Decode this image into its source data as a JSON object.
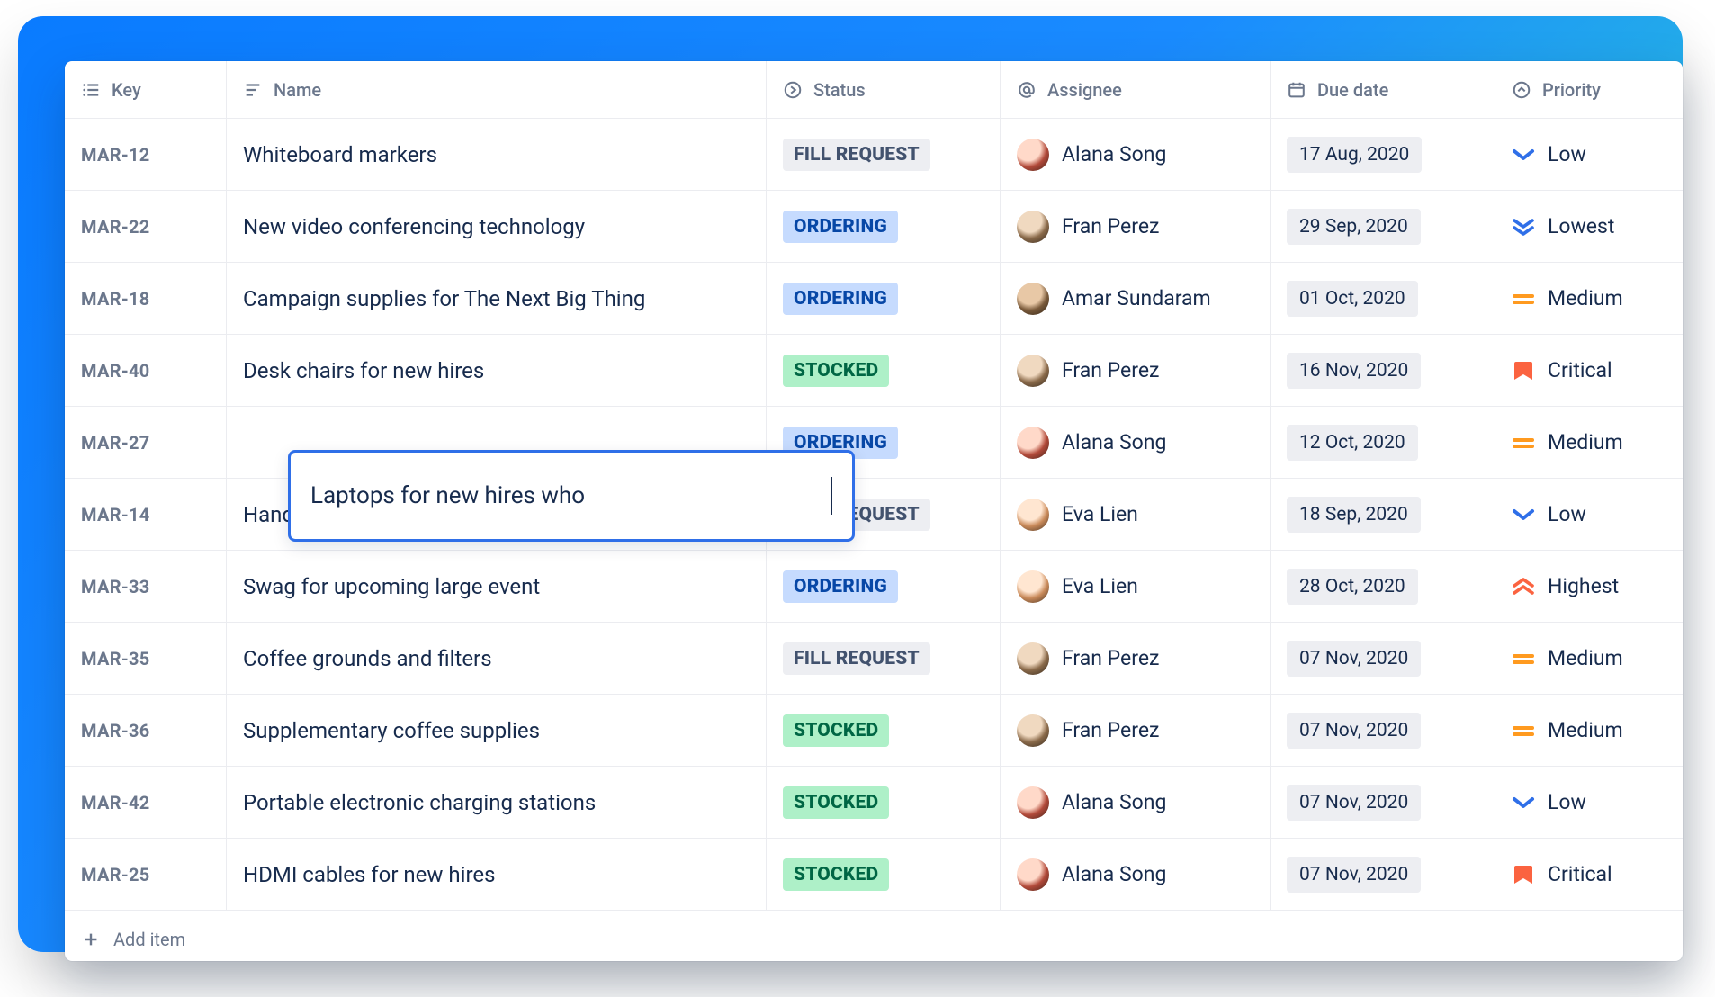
{
  "columns": {
    "key": "Key",
    "name": "Name",
    "status": "Status",
    "assignee": "Assignee",
    "due": "Due date",
    "priority": "Priority"
  },
  "footer": {
    "add_label": "Add item"
  },
  "editing": {
    "row_index": 4,
    "value": "Laptops for new hires who "
  },
  "status_styles": {
    "FILL REQUEST": "status-fill",
    "ORDERING": "status-order",
    "STOCKED": "status-stock"
  },
  "priority_icons": {
    "Low": "chev-down-1-blue",
    "Lowest": "chev-down-2-blue",
    "Medium": "bars-orange",
    "Critical": "bookmark-red",
    "Highest": "chev-up-2-red"
  },
  "avatar_classes": {
    "Alana Song": "av-alana",
    "Fran Perez": "av-fran",
    "Amar Sundaram": "av-amar",
    "Eva Lien": "av-eva"
  },
  "rows": [
    {
      "key": "MAR-12",
      "name": "Whiteboard markers",
      "status": "FILL REQUEST",
      "assignee": "Alana Song",
      "due": "17 Aug, 2020",
      "priority": "Low"
    },
    {
      "key": "MAR-22",
      "name": "New video conferencing technology",
      "status": "ORDERING",
      "assignee": "Fran Perez",
      "due": "29 Sep, 2020",
      "priority": "Lowest"
    },
    {
      "key": "MAR-18",
      "name": "Campaign supplies for The Next Big Thing",
      "status": "ORDERING",
      "assignee": "Amar Sundaram",
      "due": "01 Oct, 2020",
      "priority": "Medium"
    },
    {
      "key": "MAR-40",
      "name": "Desk chairs for new hires",
      "status": "STOCKED",
      "assignee": "Fran Perez",
      "due": "16 Nov, 2020",
      "priority": "Critical"
    },
    {
      "key": "MAR-27",
      "name": "Laptops for new hires who",
      "status": "ORDERING",
      "assignee": "Alana Song",
      "due": "12 Oct, 2020",
      "priority": "Medium"
    },
    {
      "key": "MAR-14",
      "name": "Hand sanitizer for desks and common area",
      "status": "FILL REQUEST",
      "assignee": "Eva Lien",
      "due": "18 Sep, 2020",
      "priority": "Low"
    },
    {
      "key": "MAR-33",
      "name": "Swag for upcoming large event",
      "status": "ORDERING",
      "assignee": "Eva Lien",
      "due": "28 Oct, 2020",
      "priority": "Highest"
    },
    {
      "key": "MAR-35",
      "name": "Coffee grounds and filters",
      "status": "FILL REQUEST",
      "assignee": "Fran Perez",
      "due": "07 Nov, 2020",
      "priority": "Medium"
    },
    {
      "key": "MAR-36",
      "name": "Supplementary coffee supplies",
      "status": "STOCKED",
      "assignee": "Fran Perez",
      "due": "07 Nov, 2020",
      "priority": "Medium"
    },
    {
      "key": "MAR-42",
      "name": "Portable electronic charging stations",
      "status": "STOCKED",
      "assignee": "Alana Song",
      "due": "07 Nov, 2020",
      "priority": "Low"
    },
    {
      "key": "MAR-25",
      "name": "HDMI cables for new hires",
      "status": "STOCKED",
      "assignee": "Alana Song",
      "due": "07 Nov, 2020",
      "priority": "Critical"
    }
  ]
}
